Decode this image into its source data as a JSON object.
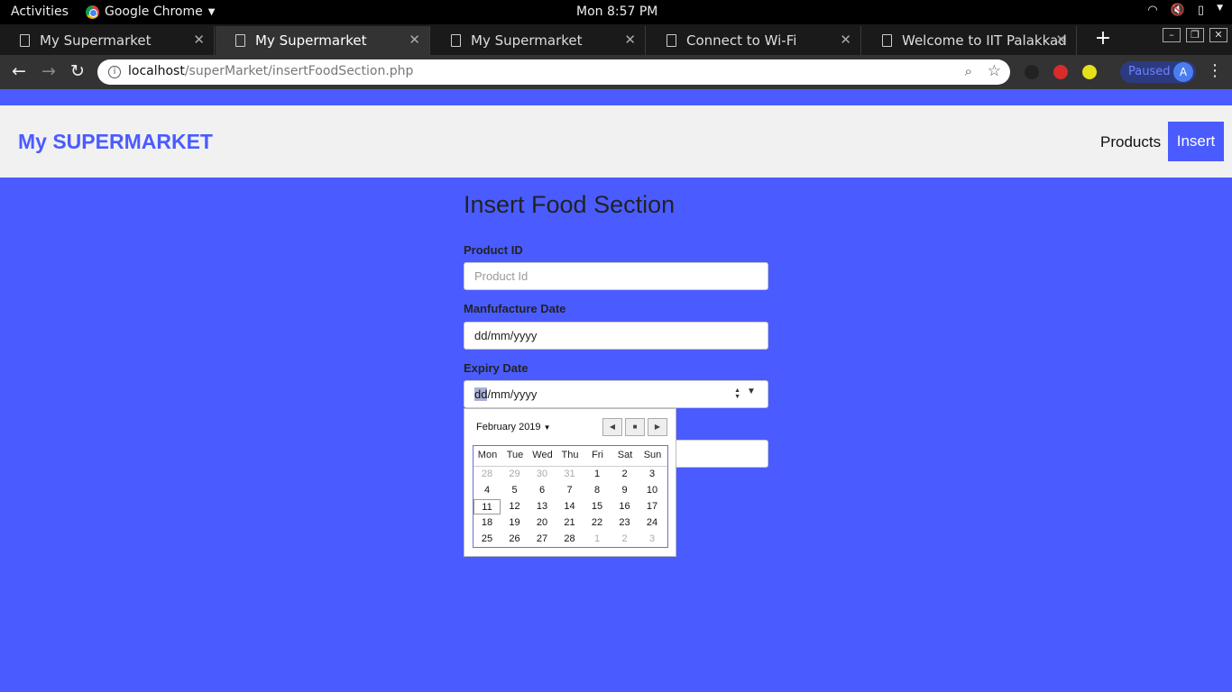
{
  "system_bar": {
    "activities": "Activities",
    "app_name": "Google Chrome",
    "clock": "Mon  8:57 PM"
  },
  "tabs": [
    {
      "title": "My Supermarket"
    },
    {
      "title": "My Supermarket"
    },
    {
      "title": "My Supermarket"
    },
    {
      "title": "Connect to Wi-Fi"
    },
    {
      "title": "Welcome to IIT Palakkad"
    }
  ],
  "toolbar": {
    "url_host": "localhost",
    "url_path": "/superMarket/insertFoodSection.php",
    "profile_status": "Paused",
    "avatar_letter": "A"
  },
  "site": {
    "brand": "My SUPERMARKET",
    "nav_products": "Products",
    "nav_insert": "Insert"
  },
  "form": {
    "title": "Insert Food Section",
    "product_id": {
      "label": "Product ID",
      "placeholder": "Product Id"
    },
    "manufacture_date": {
      "label": "Manfufacture Date",
      "value": "dd/mm/yyyy"
    },
    "expiry_date": {
      "label": "Expiry Date",
      "selected_part": "dd",
      "rest": "/mm/yyyy"
    }
  },
  "calendar": {
    "month_label": "February 2019",
    "weekdays": [
      "Mon",
      "Tue",
      "Wed",
      "Thu",
      "Fri",
      "Sat",
      "Sun"
    ],
    "weeks": [
      [
        "28",
        "29",
        "30",
        "31",
        "1",
        "2",
        "3"
      ],
      [
        "4",
        "5",
        "6",
        "7",
        "8",
        "9",
        "10"
      ],
      [
        "11",
        "12",
        "13",
        "14",
        "15",
        "16",
        "17"
      ],
      [
        "18",
        "19",
        "20",
        "21",
        "22",
        "23",
        "24"
      ],
      [
        "25",
        "26",
        "27",
        "28",
        "1",
        "2",
        "3"
      ]
    ],
    "today": "11"
  }
}
